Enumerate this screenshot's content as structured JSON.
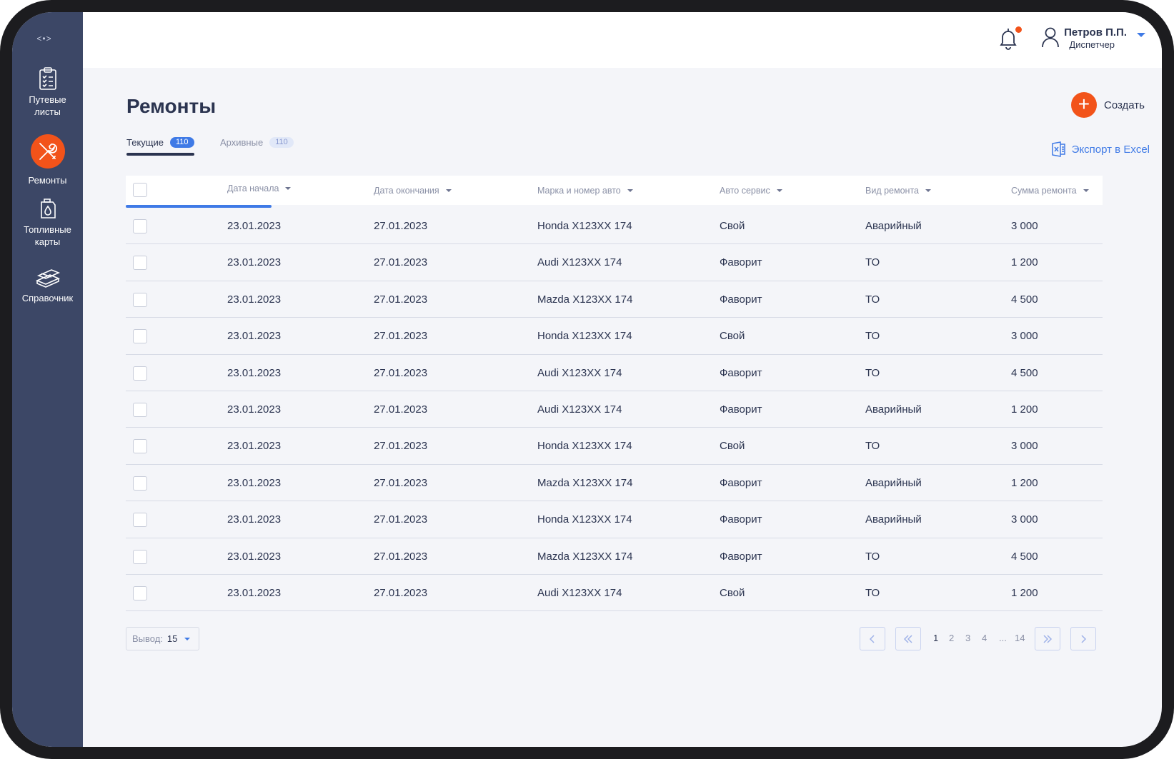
{
  "sidebar": {
    "collapse_label": "<•>",
    "items": [
      {
        "label_line1": "Путевые",
        "label_line2": "листы",
        "icon": "clipboard-icon"
      },
      {
        "label": "Ремонты",
        "icon": "wrench-screwdriver-icon",
        "active": true
      },
      {
        "label_line1": "Топливные",
        "label_line2": "карты",
        "icon": "fuel-canister-icon"
      },
      {
        "label": "Справочник",
        "icon": "books-icon"
      }
    ]
  },
  "header": {
    "user_name": "Петров П.П.",
    "user_role": "Диспетчер"
  },
  "page": {
    "title": "Ремонты",
    "create_label": "Создать",
    "export_label": "Экспорт в Excel",
    "tabs": [
      {
        "label": "Текущие",
        "count": "110"
      },
      {
        "label": "Архивные",
        "count": "110"
      }
    ]
  },
  "table": {
    "columns": [
      "Дата начала",
      "Дата окончания",
      "Марка и номер авто",
      "Авто сервис",
      "Вид ремонта",
      "Сумма ремонта"
    ],
    "rows": [
      [
        "23.01.2023",
        "27.01.2023",
        "Honda X123XX 174",
        "Свой",
        "Аварийный",
        "3 000"
      ],
      [
        "23.01.2023",
        "27.01.2023",
        "Audi X123XX 174",
        "Фаворит",
        "ТО",
        "1 200"
      ],
      [
        "23.01.2023",
        "27.01.2023",
        "Mazda X123XX 174",
        "Фаворит",
        "ТО",
        "4 500"
      ],
      [
        "23.01.2023",
        "27.01.2023",
        "Honda X123XX 174",
        "Свой",
        "ТО",
        "3 000"
      ],
      [
        "23.01.2023",
        "27.01.2023",
        "Audi X123XX 174",
        "Фаворит",
        "ТО",
        "4 500"
      ],
      [
        "23.01.2023",
        "27.01.2023",
        "Audi X123XX 174",
        "Фаворит",
        "Аварийный",
        "1 200"
      ],
      [
        "23.01.2023",
        "27.01.2023",
        "Honda X123XX 174",
        "Свой",
        "ТО",
        "3 000"
      ],
      [
        "23.01.2023",
        "27.01.2023",
        "Mazda X123XX 174",
        "Фаворит",
        "Аварийный",
        "1 200"
      ],
      [
        "23.01.2023",
        "27.01.2023",
        "Honda X123XX 174",
        "Фаворит",
        "Аварийный",
        "3 000"
      ],
      [
        "23.01.2023",
        "27.01.2023",
        "Mazda X123XX 174",
        "Фаворит",
        "ТО",
        "4 500"
      ],
      [
        "23.01.2023",
        "27.01.2023",
        "Audi X123XX 174",
        "Свой",
        "ТО",
        "1 200"
      ]
    ]
  },
  "footer": {
    "per_page_label": "Вывод:",
    "per_page_value": "15",
    "pages": [
      "1",
      "2",
      "3",
      "4",
      "...",
      "14"
    ],
    "current_page": "1"
  },
  "colors": {
    "sidebar_bg": "#3c4766",
    "accent_orange": "#f2531a",
    "accent_blue": "#3f7ae6",
    "text_dark": "#2b3450"
  }
}
